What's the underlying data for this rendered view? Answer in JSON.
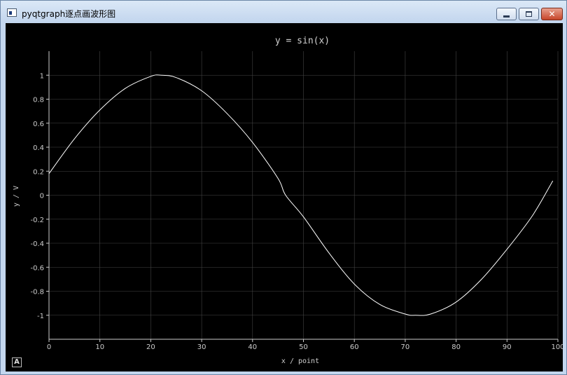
{
  "window": {
    "title": "pyqtgraph逐点画波形图",
    "icon": "app-window-icon",
    "controls": [
      "minimize-icon",
      "maximize-icon",
      "close-icon"
    ],
    "close_glyph": "✕"
  },
  "plot": {
    "auto_range_label": "A"
  },
  "colors": {
    "background": "#000000",
    "curve": "#ffffff",
    "grid": "#444444",
    "axis": "#cccccc"
  },
  "chart_data": {
    "type": "line",
    "title": "y = sin(x)",
    "xlabel": "x / point",
    "ylabel": "y / V",
    "xlim": [
      0,
      100
    ],
    "ylim": [
      -1.2,
      1.2
    ],
    "x_ticks": [
      "0",
      "10",
      "20",
      "30",
      "40",
      "50",
      "60",
      "70",
      "80",
      "90",
      "100"
    ],
    "y_ticks": [
      "1",
      "0.8",
      "0.6",
      "0.4",
      "0.2",
      "0",
      "-0.2",
      "-0.4",
      "-0.6",
      "-0.8",
      "-1"
    ],
    "grid": true,
    "series": [
      {
        "x": [
          0,
          5,
          10,
          15,
          20,
          22,
          25,
          30,
          35,
          40,
          45,
          46.5,
          50,
          55,
          60,
          65,
          70,
          72,
          75,
          80,
          85,
          90,
          95,
          99
        ],
        "values": [
          0.18,
          0.47,
          0.71,
          0.89,
          0.99,
          1.0,
          0.98,
          0.87,
          0.68,
          0.44,
          0.14,
          0.0,
          -0.18,
          -0.48,
          -0.74,
          -0.91,
          -0.99,
          -1.0,
          -0.99,
          -0.89,
          -0.7,
          -0.45,
          -0.17,
          0.12
        ]
      }
    ]
  }
}
